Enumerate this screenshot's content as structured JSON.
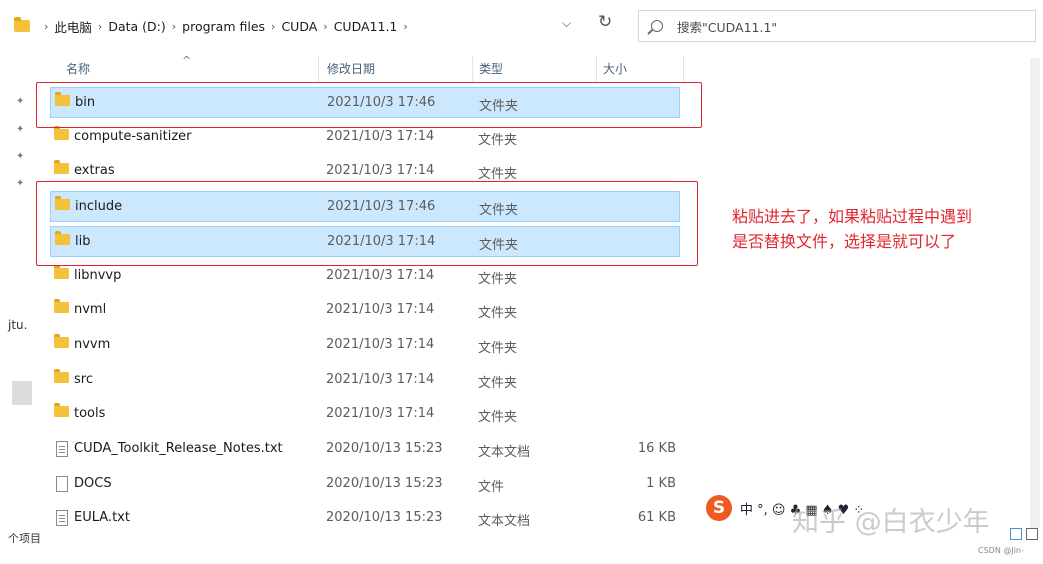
{
  "address": {
    "crumbs": [
      "此电脑",
      "Data (D:)",
      "program files",
      "CUDA",
      "CUDA11.1"
    ],
    "search_placeholder": "搜索\"CUDA11.1\""
  },
  "columns": {
    "name": "名称",
    "date": "修改日期",
    "type": "类型",
    "size": "大小"
  },
  "rows": [
    {
      "name": "bin",
      "date": "2021/10/3 17:46",
      "type": "文件夹",
      "size": "",
      "kind": "folder",
      "selected": true
    },
    {
      "name": "compute-sanitizer",
      "date": "2021/10/3 17:14",
      "type": "文件夹",
      "size": "",
      "kind": "folder",
      "selected": false
    },
    {
      "name": "extras",
      "date": "2021/10/3 17:14",
      "type": "文件夹",
      "size": "",
      "kind": "folder",
      "selected": false
    },
    {
      "name": "include",
      "date": "2021/10/3 17:46",
      "type": "文件夹",
      "size": "",
      "kind": "folder",
      "selected": true
    },
    {
      "name": "lib",
      "date": "2021/10/3 17:14",
      "type": "文件夹",
      "size": "",
      "kind": "folder",
      "selected": true
    },
    {
      "name": "libnvvp",
      "date": "2021/10/3 17:14",
      "type": "文件夹",
      "size": "",
      "kind": "folder",
      "selected": false
    },
    {
      "name": "nvml",
      "date": "2021/10/3 17:14",
      "type": "文件夹",
      "size": "",
      "kind": "folder",
      "selected": false
    },
    {
      "name": "nvvm",
      "date": "2021/10/3 17:14",
      "type": "文件夹",
      "size": "",
      "kind": "folder",
      "selected": false
    },
    {
      "name": "src",
      "date": "2021/10/3 17:14",
      "type": "文件夹",
      "size": "",
      "kind": "folder",
      "selected": false
    },
    {
      "name": "tools",
      "date": "2021/10/3 17:14",
      "type": "文件夹",
      "size": "",
      "kind": "folder",
      "selected": false
    },
    {
      "name": "CUDA_Toolkit_Release_Notes.txt",
      "date": "2020/10/13 15:23",
      "type": "文本文档",
      "size": "16 KB",
      "kind": "text",
      "selected": false
    },
    {
      "name": "DOCS",
      "date": "2020/10/13 15:23",
      "type": "文件",
      "size": "1 KB",
      "kind": "file",
      "selected": false
    },
    {
      "name": "EULA.txt",
      "date": "2020/10/13 15:23",
      "type": "文本文档",
      "size": "61 KB",
      "kind": "text",
      "selected": false
    }
  ],
  "annotation": {
    "line1": "粘贴进去了，如果粘贴过程中遇到",
    "line2": "是否替换文件，选择是就可以了",
    "color": "#e0262e"
  },
  "nav": {
    "partial_text": "jtu.",
    "status_text": "个项目"
  },
  "ime": {
    "label": "S",
    "glyphs": "中 °, ☺ ♣ ▦ ♠ ♥ ⁘"
  },
  "watermark": {
    "text": "知乎 @白衣少年",
    "csdn": "CSDN @Jin-"
  },
  "colors": {
    "selection": "#cce8ff",
    "selection_border": "#99d1ff",
    "folder": "#f3c13a",
    "annotation_red": "#d9252f"
  }
}
